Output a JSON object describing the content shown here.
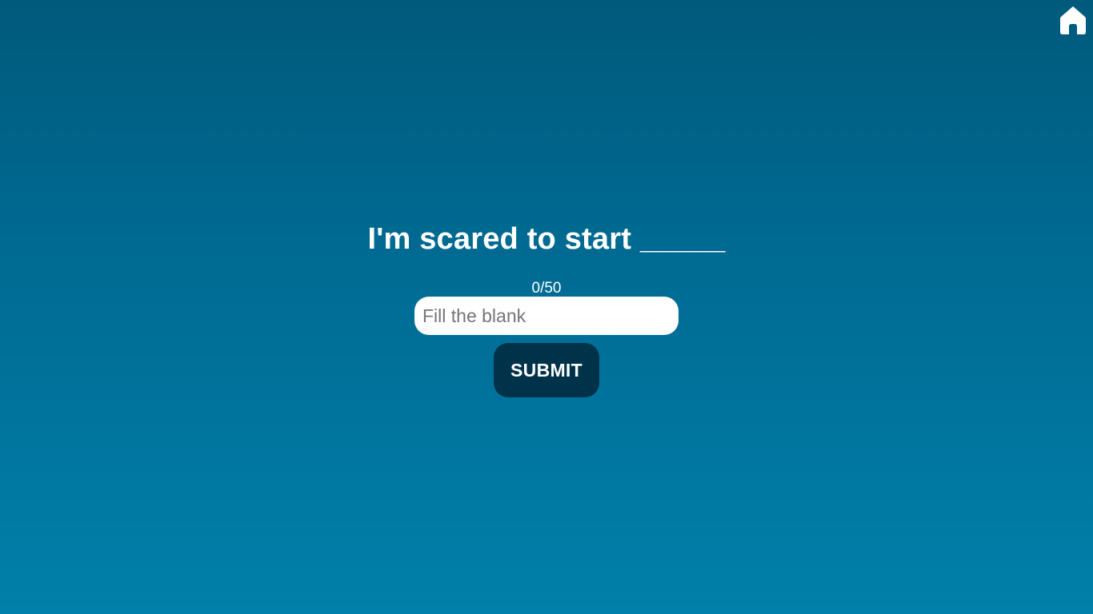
{
  "header": {
    "home_icon": "home-icon"
  },
  "main": {
    "prompt": "I'm scared to start _____",
    "counter": "0/50",
    "input": {
      "value": "",
      "placeholder": "Fill the blank"
    },
    "submit_label": "SUBMIT"
  },
  "colors": {
    "background_top": "#005a7c",
    "background_bottom": "#0080aa",
    "button": "#00324a",
    "text": "#ffffff"
  }
}
